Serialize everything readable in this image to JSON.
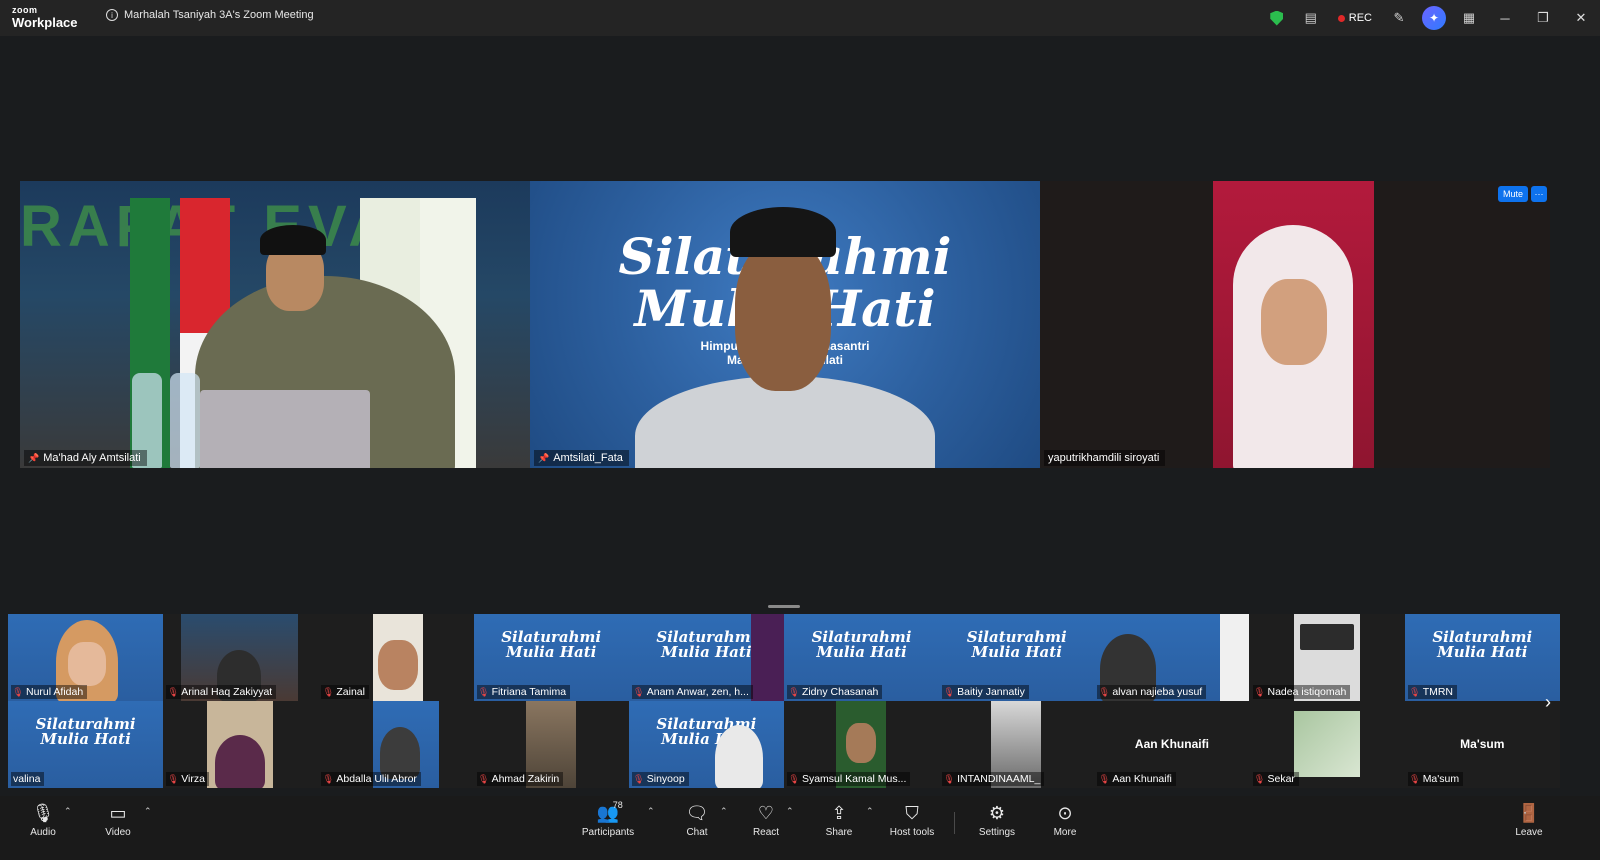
{
  "titlebar": {
    "logo_top": "zoom",
    "logo_bottom": "Workplace",
    "meeting_title": "Marhalah Tsaniyah 3A's Zoom Meeting",
    "rec_label": "REC",
    "icons": [
      "shield-icon",
      "notes-icon",
      "record-dot",
      "annotate-icon",
      "ai-companion-icon",
      "apps-icon",
      "minimize-icon",
      "restore-icon",
      "close-icon"
    ]
  },
  "main_speakers": [
    {
      "name": "Ma'had Aly Amtsilati",
      "pinned": true,
      "banner": "RAPAT EVALU"
    },
    {
      "name": "Amtsilati_Fata",
      "pinned": true,
      "slide_title_1": "Silaturahmi",
      "slide_title_2": "Mulia Hati",
      "slide_sub_1": "Himpunan Alumni Mahasantri",
      "slide_sub_2": "Ma'had Aly Amtsilati"
    },
    {
      "name": "yaputrikhamdili siroyati",
      "pinned": false
    }
  ],
  "tile_controls": {
    "mute_label": "Mute",
    "more_label": "···"
  },
  "gallery": {
    "slide_line_1": "Silaturahmi",
    "slide_line_2": "Mulia Hati",
    "row1": [
      {
        "name": "Nurul Afidah",
        "muted": true
      },
      {
        "name": "Arinal Haq Zakiyyat",
        "muted": true
      },
      {
        "name": "Zainal",
        "muted": true
      },
      {
        "name": "Fitriana Tamima",
        "muted": true
      },
      {
        "name": "Anam Anwar, zen, h...",
        "muted": true
      },
      {
        "name": "Zidny Chasanah",
        "muted": true
      },
      {
        "name": "Baitiy Jannatiy",
        "muted": true
      },
      {
        "name": "alvan najieba yusuf",
        "muted": true
      },
      {
        "name": "Nadea istiqomah",
        "muted": true
      },
      {
        "name": "TMRN",
        "muted": true
      }
    ],
    "row2": [
      {
        "name": "valina",
        "muted": false
      },
      {
        "name": "Virza",
        "muted": true
      },
      {
        "name": "Abdalla Ulil Abror",
        "muted": true
      },
      {
        "name": "Ahmad Zakirin",
        "muted": true
      },
      {
        "name": "Sinyoop",
        "muted": true
      },
      {
        "name": "Syamsul Kamal Mus...",
        "muted": true
      },
      {
        "name": "INTANDINAAML_",
        "muted": true
      },
      {
        "name": "Aan Khunaifi",
        "muted": true,
        "card": "Aan Khunaifi"
      },
      {
        "name": "Sekar",
        "muted": true
      },
      {
        "name": "Ma'sum",
        "muted": true,
        "card": "Ma'sum"
      }
    ]
  },
  "toolbar": {
    "audio": "Audio",
    "video": "Video",
    "participants": "Participants",
    "participants_count": "78",
    "chat": "Chat",
    "react": "React",
    "share": "Share",
    "host_tools": "Host tools",
    "settings": "Settings",
    "more": "More",
    "leave": "Leave"
  },
  "colors": {
    "accent_blue": "#0e72ed",
    "rec_red": "#e02828",
    "muted_red": "#e84545",
    "shield_green": "#2bbd4e"
  }
}
